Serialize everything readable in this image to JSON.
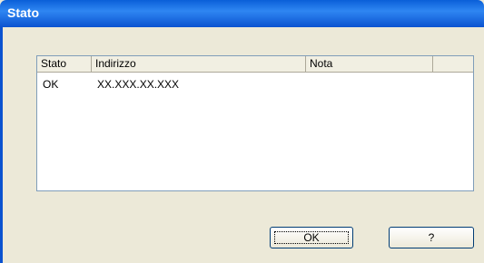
{
  "window": {
    "title": "Stato"
  },
  "list": {
    "columns": [
      "Stato",
      "Indirizzo",
      "Nota",
      ""
    ],
    "rows": [
      {
        "stato": "OK",
        "indirizzo": "XX.XXX.XX.XXX",
        "nota": ""
      }
    ]
  },
  "buttons": {
    "ok": "OK",
    "help": "?"
  }
}
